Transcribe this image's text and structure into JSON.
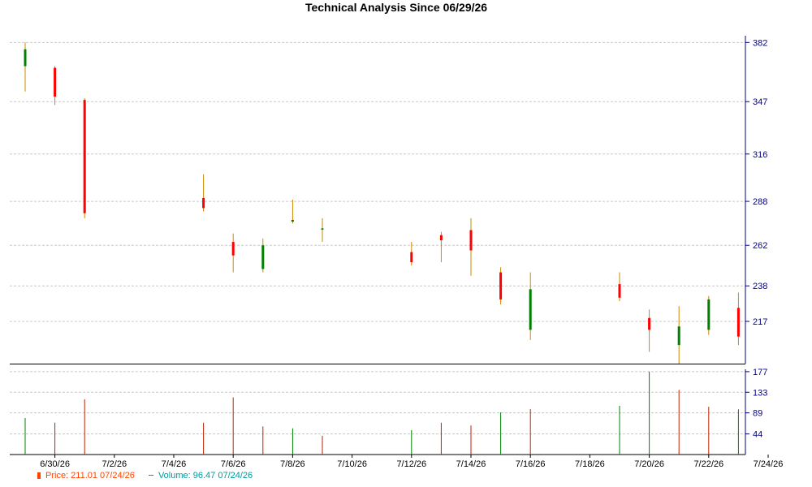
{
  "chart_data": {
    "type": "candlestick",
    "title": "Technical Analysis Since 06/29/26",
    "x_dates": [
      "6/29/26",
      "6/30/26",
      "7/1/26",
      "7/2/26",
      "7/3/26",
      "7/4/26",
      "7/5/26",
      "7/6/26",
      "7/7/26",
      "7/8/26",
      "7/9/26",
      "7/10/26",
      "7/11/26",
      "7/12/26",
      "7/13/26",
      "7/14/26",
      "7/15/26",
      "7/16/26",
      "7/17/26",
      "7/18/26",
      "7/19/26",
      "7/20/26",
      "7/21/26",
      "7/22/26",
      "7/23/26",
      "7/24/26"
    ],
    "x_tick_labels": [
      "6/30/26",
      "7/2/26",
      "7/4/26",
      "7/6/26",
      "7/8/26",
      "7/10/26",
      "7/12/26",
      "7/14/26",
      "7/16/26",
      "7/18/26",
      "7/20/26",
      "7/22/26",
      "7/24/26"
    ],
    "price_axis": {
      "ticks": [
        382,
        347,
        316,
        288,
        262,
        238,
        217
      ],
      "range": [
        192,
        386
      ],
      "side": "right",
      "grid": true
    },
    "volume_axis": {
      "ticks": [
        177,
        133,
        89,
        44
      ],
      "range": [
        0,
        182
      ],
      "side": "right",
      "grid": true
    },
    "candles": [
      {
        "date": "6/29/26",
        "open": 368,
        "high": 382,
        "low": 353,
        "close": 378
      },
      {
        "date": "6/30/26",
        "open": 367,
        "high": 368,
        "low": 345,
        "close": 350
      },
      {
        "date": "7/1/26",
        "open": 348,
        "high": 349,
        "low": 278,
        "close": 281
      },
      {
        "date": "7/5/26",
        "open": 290,
        "high": 304,
        "low": 282,
        "close": 284
      },
      {
        "date": "7/6/26",
        "open": 264,
        "high": 269,
        "low": 246,
        "close": 256
      },
      {
        "date": "7/7/26",
        "open": 248,
        "high": 266,
        "low": 246,
        "close": 262
      },
      {
        "date": "7/8/26",
        "open": 276,
        "high": 289,
        "low": 275,
        "close": 277
      },
      {
        "date": "7/9/26",
        "open": 272,
        "high": 278,
        "low": 264,
        "close": 272
      },
      {
        "date": "7/12/26",
        "open": 258,
        "high": 264,
        "low": 250,
        "close": 252
      },
      {
        "date": "7/13/26",
        "open": 268,
        "high": 270,
        "low": 252,
        "close": 265
      },
      {
        "date": "7/14/26",
        "open": 271,
        "high": 278,
        "low": 244,
        "close": 259
      },
      {
        "date": "7/15/26",
        "open": 246,
        "high": 249,
        "low": 227,
        "close": 230
      },
      {
        "date": "7/16/26",
        "open": 212,
        "high": 246,
        "low": 206,
        "close": 236
      },
      {
        "date": "7/19/26",
        "open": 239,
        "high": 246,
        "low": 229,
        "close": 231
      },
      {
        "date": "7/20/26",
        "open": 219,
        "high": 224,
        "low": 199,
        "close": 212
      },
      {
        "date": "7/21/26",
        "open": 203,
        "high": 226,
        "low": 192,
        "close": 214
      },
      {
        "date": "7/22/26",
        "open": 212,
        "high": 232,
        "low": 209,
        "close": 230
      },
      {
        "date": "7/23/26",
        "open": 225,
        "high": 234,
        "low": 203,
        "close": 208
      }
    ],
    "volume_bars": [
      {
        "date": "6/29/26",
        "value": 78,
        "color": "#008000"
      },
      {
        "date": "6/30/26",
        "value": 68,
        "color": "#bb2200"
      },
      {
        "date": "7/1/26",
        "value": 118,
        "color": "#bb2200"
      },
      {
        "date": "7/5/26",
        "value": 68,
        "color": "#bb2200"
      },
      {
        "date": "7/6/26",
        "value": 122,
        "color": "#bb2200"
      },
      {
        "date": "7/7/26",
        "value": 60,
        "color": "#bb2200"
      },
      {
        "date": "7/8/26",
        "value": 56,
        "color": "#008000"
      },
      {
        "date": "7/9/26",
        "value": 40,
        "color": "#bb2200"
      },
      {
        "date": "7/12/26",
        "value": 52,
        "color": "#008000"
      },
      {
        "date": "7/13/26",
        "value": 68,
        "color": "#bb2200"
      },
      {
        "date": "7/14/26",
        "value": 62,
        "color": "#bb2200"
      },
      {
        "date": "7/15/26",
        "value": 90,
        "color": "#008000"
      },
      {
        "date": "7/16/26",
        "value": 97,
        "color": "#bb2200"
      },
      {
        "date": "7/19/26",
        "value": 104,
        "color": "#008000"
      },
      {
        "date": "7/20/26",
        "value": 177,
        "color": "#008000"
      },
      {
        "date": "7/21/26",
        "value": 138,
        "color": "#bb2200"
      },
      {
        "date": "7/22/26",
        "value": 102,
        "color": "#bb2200"
      },
      {
        "date": "7/23/26",
        "value": 96.47,
        "color": "#008000"
      }
    ],
    "colors": {
      "up": "#008000",
      "down": "#ff0000",
      "wick": "#cc8800",
      "price_axis_text": "#000080",
      "volume_axis_text": "#000080",
      "grid": "#c8c8c8"
    },
    "legend": {
      "position": "bottom-left",
      "price_label": "Price: 211.01  07/24/26",
      "volume_label": "Volume: 96.47  07/24/26",
      "price_color": "#ff4400",
      "volume_color": "#009999"
    }
  }
}
